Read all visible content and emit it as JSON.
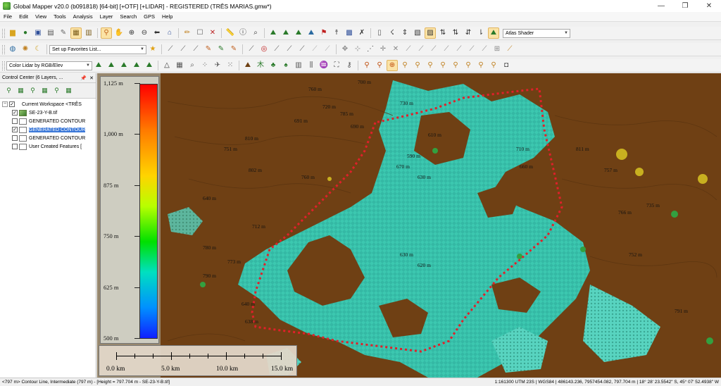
{
  "window": {
    "title": "Global Mapper v20.0 (b091818) [64-bit] [+OTF] [+LIDAR] - REGISTERED (TRÊS MARIAS.gmw*)",
    "minimize": "—",
    "maximize": "❐",
    "close": "✕"
  },
  "menu": [
    "File",
    "Edit",
    "View",
    "Tools",
    "Analysis",
    "Layer",
    "Search",
    "GPS",
    "Help"
  ],
  "toolbar": {
    "shader_select": "Atlas Shader",
    "favorites_select": "Set up Favorites List...",
    "lidar_color_select": "Color Lidar by RGB/Elev"
  },
  "control_center": {
    "title": "Control Center (6 Layers, ...",
    "pin": "📌",
    "close": "✕",
    "workspace": "Current Workspace <TRÊS",
    "layers": [
      {
        "name": "SE-23-Y-B.tif",
        "checked": true,
        "selected": false,
        "kind": "raster"
      },
      {
        "name": "GENERATED CONTOUR",
        "checked": false,
        "selected": false,
        "kind": "contour"
      },
      {
        "name": "GENERATED CONTOUR",
        "checked": true,
        "selected": true,
        "kind": "contour"
      },
      {
        "name": "GENERATED CONTOUR",
        "checked": false,
        "selected": false,
        "kind": "contour"
      },
      {
        "name": "User Created Features [",
        "checked": false,
        "selected": false,
        "kind": "features"
      }
    ]
  },
  "legend": {
    "labels": [
      "1,125 m",
      "1,000 m",
      "875 m",
      "750 m",
      "625 m",
      "500 m"
    ],
    "min": 500,
    "max": 1125
  },
  "scale_bar": {
    "labels": [
      "0.0 km",
      "5.0 km",
      "10.0 km",
      "15.0 km"
    ]
  },
  "contour_labels": [
    "760 m",
    "720 m",
    "700 m",
    "785 m",
    "690 m",
    "730 m",
    "691 m",
    "810 m",
    "802 m",
    "760 m",
    "751 m",
    "670 m",
    "630 m",
    "610 m",
    "710 m",
    "660 m",
    "590 m",
    "640 m",
    "780 m",
    "773 m",
    "712 m",
    "630 m",
    "791 m",
    "811 m",
    "757 m",
    "766 m",
    "790 m",
    "735 m",
    "640 m",
    "638 m",
    "620 m",
    "752 m"
  ],
  "status": {
    "left": "<797 m> Contour Line, Intermediate (797 m) - [Height = 797.704 m - SE-23-Y-B.tif]",
    "right": "1:161300  UTM 23S | WGS84 | 486143.236, 7957454.082, 797.704 m | 18° 28' 23.5542\" S, 45° 07' 52.4938\" W"
  }
}
